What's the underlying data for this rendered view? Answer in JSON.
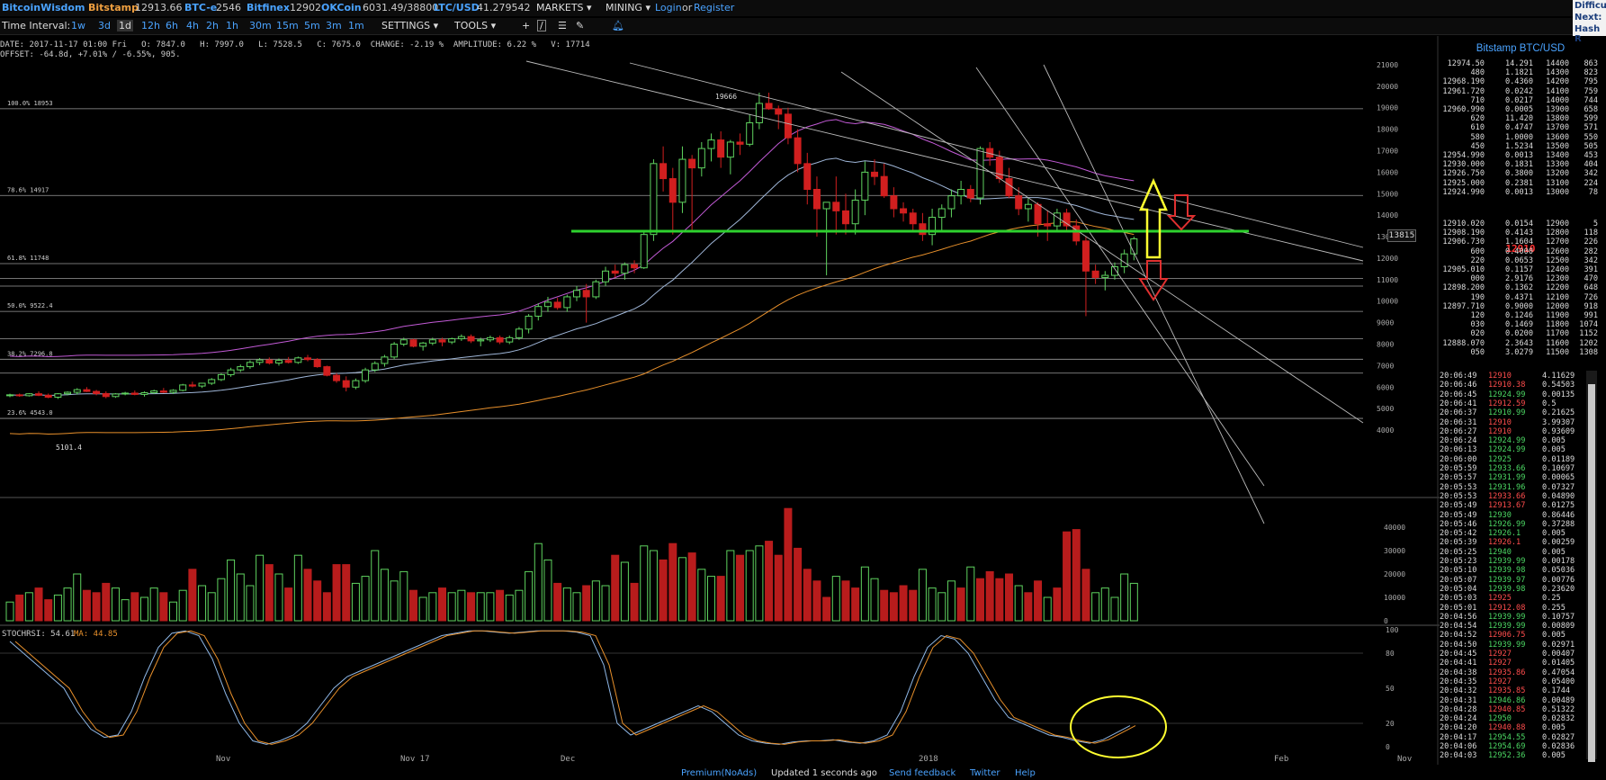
{
  "topbar": {
    "brand": "BitcoinWisdom",
    "exchanges": [
      {
        "name": "Bitstamp",
        "price": "12913.66"
      },
      {
        "name": "BTC-e",
        "price": "2546"
      },
      {
        "name": "Bitfinex",
        "price": "12902"
      },
      {
        "name": "OKCoin",
        "price": "6031.49/38800"
      },
      {
        "name": "LTC/USD",
        "price": "41.279542"
      }
    ],
    "markets": "MARKETS",
    "mining": "MINING",
    "login": "Login",
    "or": "or",
    "register": "Register"
  },
  "side_panel": {
    "line1": "Difficu",
    "line2": "Next:",
    "line3": "Hash R"
  },
  "toolbar": {
    "label": "Time Interval:",
    "intervals": [
      "1w",
      "3d",
      "1d",
      "12h",
      "6h",
      "4h",
      "2h",
      "1h",
      "30m",
      "15m",
      "5m",
      "3m",
      "1m"
    ],
    "active": "1d",
    "settings": "SETTINGS",
    "tools": "TOOLS"
  },
  "info": {
    "line1": "DATE: 2017-11-17 01:00 Fri   O: 7847.0   H: 7997.0   L: 7528.5   C: 7675.0  CHANGE: -2.19 %  AMPLITUDE: 6.22 %   V: 17714",
    "line2": "OFFSET: -64.8d, +7.01% / -6.55%, 905."
  },
  "chart_data": {
    "type": "candlestick",
    "price_axis": {
      "ticks": [
        4000,
        5000,
        6000,
        7000,
        8000,
        9000,
        10000,
        11000,
        12000,
        13000,
        14000,
        15000,
        16000,
        17000,
        18000,
        19000,
        20000,
        21000
      ],
      "labels": [
        "4000",
        "5000",
        "6000",
        "7000",
        "8000",
        "9000",
        "10000",
        "11000",
        "12000",
        "13000",
        "14000",
        "15000",
        "16000",
        "17000",
        "18000",
        "19000",
        "20000",
        "21000"
      ],
      "range": [
        3500,
        21500
      ]
    },
    "volume_axis": {
      "ticks": [
        0,
        10000,
        20000,
        30000,
        40000
      ],
      "labels": [
        "0",
        "10000",
        "20000",
        "30000",
        "40000"
      ],
      "range": [
        0,
        50000
      ]
    },
    "rsi_axis": {
      "ticks": [
        0,
        20,
        50,
        80,
        100
      ],
      "labels": [
        "0",
        "20",
        "50",
        "80",
        "100"
      ],
      "range": [
        0,
        100
      ]
    },
    "x_labels": [
      "Nov",
      "Nov 17",
      "Dec",
      "2018",
      "Feb",
      "Nov"
    ],
    "fib_levels": [
      {
        "label": "100.0% 18953",
        "value": 18953
      },
      {
        "label": "78.6% 14917",
        "value": 14917
      },
      {
        "label": "61.8% 11748",
        "value": 11748
      },
      {
        "label": "50.0% 9522.4",
        "value": 9522.4
      },
      {
        "label": "38.2% 7296.8",
        "value": 7296.8
      },
      {
        "label": "23.6% 4543.0",
        "value": 4543.0
      }
    ],
    "high_label": "19666",
    "low_label": "5101.4",
    "last_price_tag": "13815",
    "rsi_label": "STOCHRSI: 54.61",
    "rsi_ma_label": "MA: 44.85",
    "candles": [
      [
        5600,
        5690,
        5530,
        5640
      ],
      [
        5640,
        5700,
        5550,
        5600
      ],
      [
        5600,
        5720,
        5560,
        5690
      ],
      [
        5690,
        5800,
        5580,
        5620
      ],
      [
        5620,
        5700,
        5480,
        5530
      ],
      [
        5530,
        5720,
        5450,
        5690
      ],
      [
        5690,
        5800,
        5620,
        5760
      ],
      [
        5760,
        5950,
        5650,
        5880
      ],
      [
        5880,
        6000,
        5770,
        5800
      ],
      [
        5800,
        5870,
        5620,
        5700
      ],
      [
        5700,
        5800,
        5480,
        5560
      ],
      [
        5560,
        5720,
        5500,
        5680
      ],
      [
        5680,
        5780,
        5620,
        5720
      ],
      [
        5720,
        5840,
        5620,
        5660
      ],
      [
        5660,
        5800,
        5560,
        5740
      ],
      [
        5740,
        5880,
        5680,
        5820
      ],
      [
        5820,
        5960,
        5720,
        5760
      ],
      [
        5760,
        5900,
        5680,
        5850
      ],
      [
        5850,
        6150,
        5800,
        6100
      ],
      [
        6100,
        6250,
        5990,
        6050
      ],
      [
        6050,
        6200,
        5960,
        6180
      ],
      [
        6180,
        6420,
        6100,
        6350
      ],
      [
        6350,
        6650,
        6280,
        6580
      ],
      [
        6580,
        6900,
        6480,
        6800
      ],
      [
        6800,
        7050,
        6700,
        6950
      ],
      [
        6950,
        7250,
        6850,
        7150
      ],
      [
        7150,
        7350,
        7020,
        7260
      ],
      [
        7260,
        7380,
        7050,
        7120
      ],
      [
        7120,
        7330,
        7000,
        7240
      ],
      [
        7240,
        7400,
        7100,
        7150
      ],
      [
        7150,
        7420,
        7080,
        7360
      ],
      [
        7360,
        7500,
        7200,
        7280
      ],
      [
        7280,
        7350,
        6900,
        6950
      ],
      [
        6950,
        7000,
        6500,
        6550
      ],
      [
        6550,
        6650,
        6200,
        6300
      ],
      [
        6300,
        6500,
        5800,
        6000
      ],
      [
        6000,
        6400,
        5900,
        6300
      ],
      [
        6300,
        6900,
        6200,
        6800
      ],
      [
        6800,
        7200,
        6700,
        7100
      ],
      [
        7100,
        7500,
        6950,
        7400
      ],
      [
        7400,
        8100,
        7300,
        8000
      ],
      [
        8000,
        8300,
        7900,
        8200
      ],
      [
        8200,
        8250,
        7850,
        7900
      ],
      [
        7900,
        8100,
        7700,
        8050
      ],
      [
        8050,
        8300,
        7950,
        8200
      ],
      [
        8200,
        8300,
        7900,
        8100
      ],
      [
        8100,
        8300,
        8000,
        8250
      ],
      [
        8250,
        8450,
        8150,
        8350
      ],
      [
        8350,
        8450,
        8050,
        8150
      ],
      [
        8150,
        8300,
        7900,
        8200
      ],
      [
        8200,
        8400,
        8100,
        8300
      ],
      [
        8300,
        8400,
        8000,
        8100
      ],
      [
        8100,
        8400,
        8000,
        8300
      ],
      [
        8300,
        8800,
        8200,
        8700
      ],
      [
        8700,
        9400,
        8500,
        9300
      ],
      [
        9300,
        9900,
        9100,
        9750
      ],
      [
        9750,
        10200,
        9500,
        9950
      ],
      [
        9950,
        10150,
        9600,
        9700
      ],
      [
        9700,
        10300,
        9500,
        10200
      ],
      [
        10200,
        10700,
        10000,
        10500
      ],
      [
        10500,
        10800,
        9000,
        10200
      ],
      [
        10200,
        11000,
        10100,
        10900
      ],
      [
        10900,
        11600,
        10700,
        11400
      ],
      [
        11400,
        11700,
        11100,
        11300
      ],
      [
        11300,
        11800,
        11000,
        11700
      ],
      [
        11700,
        11900,
        11300,
        11550
      ],
      [
        11550,
        13200,
        11500,
        13100
      ],
      [
        13100,
        16600,
        12800,
        16400
      ],
      [
        16400,
        17200,
        15100,
        15700
      ],
      [
        15700,
        16200,
        13100,
        14600
      ],
      [
        14600,
        17200,
        14100,
        16600
      ],
      [
        16600,
        16800,
        13200,
        16200
      ],
      [
        16200,
        17400,
        15800,
        17100
      ],
      [
        17100,
        17800,
        16500,
        17500
      ],
      [
        17500,
        17900,
        16200,
        16700
      ],
      [
        16700,
        17500,
        15900,
        17400
      ],
      [
        17400,
        17800,
        16800,
        17300
      ],
      [
        17300,
        18700,
        17200,
        18300
      ],
      [
        18300,
        19700,
        18000,
        19200
      ],
      [
        19200,
        19700,
        18900,
        18950
      ],
      [
        18950,
        19100,
        18000,
        18700
      ],
      [
        18700,
        19000,
        17300,
        17600
      ],
      [
        17600,
        18000,
        16000,
        16400
      ],
      [
        16400,
        16900,
        14500,
        15200
      ],
      [
        15200,
        15800,
        13000,
        14300
      ],
      [
        14300,
        14600,
        11200,
        14600
      ],
      [
        14600,
        15800,
        13100,
        14200
      ],
      [
        14200,
        15000,
        13100,
        13600
      ],
      [
        13600,
        15200,
        13100,
        14700
      ],
      [
        14700,
        16500,
        14000,
        16000
      ],
      [
        16000,
        16600,
        15400,
        15800
      ],
      [
        15800,
        16400,
        14800,
        14900
      ],
      [
        14900,
        15300,
        13900,
        14300
      ],
      [
        14300,
        14600,
        13700,
        14100
      ],
      [
        14100,
        14300,
        13300,
        13600
      ],
      [
        13600,
        14100,
        12800,
        13100
      ],
      [
        13100,
        14300,
        12600,
        13900
      ],
      [
        13900,
        14500,
        13300,
        14300
      ],
      [
        14300,
        15200,
        13900,
        14900
      ],
      [
        14900,
        15600,
        14500,
        15200
      ],
      [
        15200,
        15400,
        14600,
        14800
      ],
      [
        14800,
        17200,
        14500,
        17100
      ],
      [
        17100,
        17400,
        16300,
        16700
      ],
      [
        16700,
        17000,
        15500,
        15700
      ],
      [
        15700,
        16200,
        14800,
        14900
      ],
      [
        14900,
        15300,
        14000,
        14300
      ],
      [
        14300,
        14800,
        13700,
        14500
      ],
      [
        14500,
        14600,
        13000,
        13600
      ],
      [
        13600,
        14200,
        12800,
        13500
      ],
      [
        13500,
        14300,
        13200,
        14100
      ],
      [
        14100,
        14300,
        13300,
        13500
      ],
      [
        13500,
        13800,
        12600,
        12800
      ],
      [
        12800,
        13000,
        9300,
        11400
      ],
      [
        11400,
        11700,
        10800,
        11100
      ],
      [
        11100,
        11400,
        10500,
        11200
      ],
      [
        11200,
        11800,
        11000,
        11600
      ],
      [
        11600,
        12400,
        11300,
        12200
      ],
      [
        12200,
        13000,
        11900,
        12900
      ]
    ],
    "volumes": [
      8000,
      11000,
      12000,
      14000,
      9000,
      11000,
      14000,
      20000,
      13000,
      12000,
      16000,
      14000,
      9000,
      12000,
      10000,
      14000,
      12000,
      8000,
      13000,
      22000,
      15000,
      12000,
      18000,
      26000,
      20000,
      15000,
      28000,
      24000,
      20000,
      14000,
      28000,
      22000,
      17000,
      12000,
      24000,
      24000,
      16000,
      19000,
      30000,
      22000,
      17000,
      21000,
      13000,
      10000,
      12000,
      14000,
      12000,
      13000,
      12000,
      12000,
      12000,
      13000,
      11000,
      13000,
      21000,
      33000,
      26000,
      16000,
      14000,
      12000,
      15000,
      17000,
      15000,
      28000,
      25000,
      16000,
      32000,
      30000,
      26000,
      33000,
      27000,
      29000,
      22000,
      19000,
      19000,
      30000,
      28000,
      30000,
      32000,
      34000,
      28000,
      48000,
      31000,
      22000,
      17000,
      10000,
      19000,
      17000,
      14000,
      23000,
      18000,
      13000,
      12000,
      15000,
      13000,
      22000,
      14000,
      12000,
      17000,
      14000,
      23000,
      18000,
      21000,
      18000,
      20000,
      15000,
      12000,
      17000,
      10000,
      14000,
      38000,
      39000,
      22000,
      12000,
      14000,
      10000,
      20000,
      16000
    ],
    "volume_colors": "g r g r r g g g r r r g g r g g r g g r g g g g g g g r g r g r r r r r g g g g g g r g g r g g r g g r g g g g g r g g r g g r g r g g r r g r g g r g r g g r r r r r r r g r r g g r r r r g g g g r g r r r r g r r g r r r r g g g g"
  },
  "orderbook": {
    "title": "Bitstamp BTC/USD",
    "asks": [
      [
        "12974.50",
        "14.291",
        "14400",
        "863"
      ],
      [
        "480",
        "1.1821",
        "14300",
        "823"
      ],
      [
        "12968.190",
        "0.4360",
        "14200",
        "795"
      ],
      [
        "12961.720",
        "0.0242",
        "14100",
        "759"
      ],
      [
        "710",
        "0.0217",
        "14000",
        "744"
      ],
      [
        "12960.990",
        "0.0005",
        "13900",
        "658"
      ],
      [
        "620",
        "11.420",
        "13800",
        "599"
      ],
      [
        "610",
        "0.4747",
        "13700",
        "571"
      ],
      [
        "580",
        "1.0000",
        "13600",
        "550"
      ],
      [
        "450",
        "1.5234",
        "13500",
        "505"
      ],
      [
        "12954.990",
        "0.0013",
        "13400",
        "453"
      ],
      [
        "12930.000",
        "0.1831",
        "13300",
        "404"
      ],
      [
        "12926.750",
        "0.3800",
        "13200",
        "342"
      ],
      [
        "12925.000",
        "0.2381",
        "13100",
        "224"
      ],
      [
        "12924.990",
        "0.0013",
        "13000",
        "78"
      ]
    ],
    "mid": "12910",
    "bids": [
      [
        "12910.020",
        "0.0154",
        "12900",
        "5"
      ],
      [
        "12908.190",
        "0.4143",
        "12800",
        "118"
      ],
      [
        "12906.730",
        "1.1604",
        "12700",
        "226"
      ],
      [
        "600",
        "0.4000",
        "12600",
        "282"
      ],
      [
        "220",
        "0.0653",
        "12500",
        "342"
      ],
      [
        "12905.010",
        "0.1157",
        "12400",
        "391"
      ],
      [
        "000",
        "2.9176",
        "12300",
        "470"
      ],
      [
        "12898.200",
        "0.1362",
        "12200",
        "648"
      ],
      [
        "190",
        "0.4371",
        "12100",
        "726"
      ],
      [
        "12897.710",
        "0.9000",
        "12000",
        "918"
      ],
      [
        "120",
        "0.1246",
        "11900",
        "991"
      ],
      [
        "030",
        "0.1469",
        "11800",
        "1074"
      ],
      [
        "020",
        "0.0200",
        "11700",
        "1152"
      ],
      [
        "12888.070",
        "2.3643",
        "11600",
        "1202"
      ],
      [
        "050",
        "3.0279",
        "11500",
        "1308"
      ]
    ]
  },
  "trades": [
    [
      "20:06:49",
      "12910",
      "4.11629",
      "d"
    ],
    [
      "20:06:46",
      "12910.38",
      "0.54503",
      "d"
    ],
    [
      "20:06:45",
      "12924.99",
      "0.00135",
      "u"
    ],
    [
      "20:06:41",
      "12912.59",
      "0.5",
      "d"
    ],
    [
      "20:06:37",
      "12910.99",
      "0.21625",
      "u"
    ],
    [
      "20:06:31",
      "12910",
      "3.99307",
      "d"
    ],
    [
      "20:06:27",
      "12910",
      "0.93609",
      "d"
    ],
    [
      "20:06:24",
      "12924.99",
      "0.005",
      "u"
    ],
    [
      "20:06:13",
      "12924.99",
      "0.005",
      "u"
    ],
    [
      "20:06:00",
      "12925",
      "0.01189",
      "u"
    ],
    [
      "20:05:59",
      "12933.66",
      "0.10697",
      "u"
    ],
    [
      "20:05:57",
      "12931.99",
      "0.00065",
      "u"
    ],
    [
      "20:05:53",
      "12931.96",
      "0.07327",
      "u"
    ],
    [
      "20:05:53",
      "12933.66",
      "0.04890",
      "d"
    ],
    [
      "20:05:49",
      "12913.67",
      "0.01275",
      "d"
    ],
    [
      "20:05:49",
      "12930",
      "0.86446",
      "u"
    ],
    [
      "20:05:46",
      "12926.99",
      "0.37288",
      "u"
    ],
    [
      "20:05:42",
      "12926.1",
      "0.005",
      "u"
    ],
    [
      "20:05:39",
      "12926.1",
      "0.00259",
      "d"
    ],
    [
      "20:05:25",
      "12940",
      "0.005",
      "u"
    ],
    [
      "20:05:23",
      "12939.99",
      "0.00178",
      "u"
    ],
    [
      "20:05:10",
      "12939.98",
      "0.05036",
      "u"
    ],
    [
      "20:05:07",
      "12939.97",
      "0.00776",
      "u"
    ],
    [
      "20:05:04",
      "12939.98",
      "0.23620",
      "u"
    ],
    [
      "20:05:03",
      "12925",
      "0.25",
      "d"
    ],
    [
      "20:05:01",
      "12912.08",
      "0.255",
      "d"
    ],
    [
      "20:04:56",
      "12939.99",
      "0.10757",
      "u"
    ],
    [
      "20:04:54",
      "12939.99",
      "0.00809",
      "u"
    ],
    [
      "20:04:52",
      "12906.75",
      "0.005",
      "d"
    ],
    [
      "20:04:50",
      "12939.99",
      "0.02971",
      "u"
    ],
    [
      "20:04:45",
      "12927",
      "0.00407",
      "d"
    ],
    [
      "20:04:41",
      "12927",
      "0.01405",
      "d"
    ],
    [
      "20:04:38",
      "12935.86",
      "0.47054",
      "d"
    ],
    [
      "20:04:35",
      "12927",
      "0.05400",
      "d"
    ],
    [
      "20:04:32",
      "12935.85",
      "0.1744",
      "d"
    ],
    [
      "20:04:31",
      "12946.86",
      "0.00489",
      "u"
    ],
    [
      "20:04:28",
      "12940.85",
      "0.51322",
      "d"
    ],
    [
      "20:04:24",
      "12950",
      "0.02832",
      "u"
    ],
    [
      "20:04:20",
      "12940.88",
      "0.005",
      "d"
    ],
    [
      "20:04:17",
      "12954.55",
      "0.02827",
      "u"
    ],
    [
      "20:04:06",
      "12954.69",
      "0.02836",
      "u"
    ],
    [
      "20:04:03",
      "12952.36",
      "0.005",
      "u"
    ]
  ],
  "bottombar": {
    "premium": "Premium(NoAds)",
    "updated": "Updated 1 seconds ago",
    "feedback": "Send feedback",
    "twitter": "Twitter",
    "help": "Help"
  }
}
